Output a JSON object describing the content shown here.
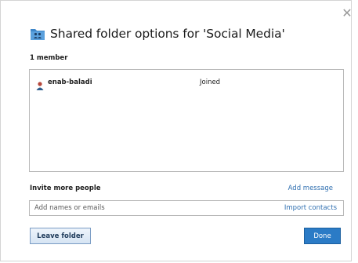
{
  "dialog": {
    "close_glyph": "✕",
    "title": "Shared folder options for 'Social Media'",
    "title_icon": "shared-folder-icon"
  },
  "members": {
    "count_label": "1 member",
    "items": [
      {
        "name": "enab-baladi",
        "status": "Joined",
        "icon": "user-icon"
      }
    ]
  },
  "invite": {
    "label": "Invite more people",
    "add_message": "Add message",
    "input_placeholder": "Add names or emails",
    "input_value": "",
    "import_contacts": "Import contacts"
  },
  "actions": {
    "leave_label": "Leave folder",
    "done_label": "Done"
  },
  "colors": {
    "accent": "#2b7bc6",
    "link": "#2f6fb0",
    "folder_blue": "#3d86c9"
  }
}
